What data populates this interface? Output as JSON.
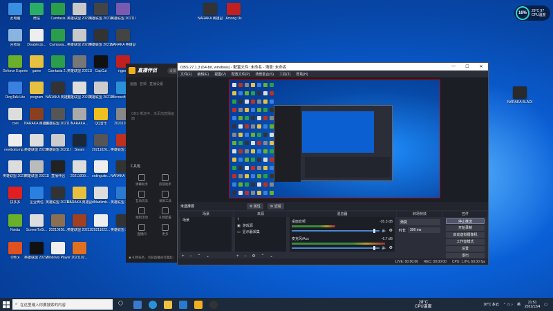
{
  "desktop": {
    "icons": [
      {
        "label": "此电脑",
        "color": "#3b8fe0"
      },
      {
        "label": "微信",
        "color": "#2aae67"
      },
      {
        "label": "Camtasia",
        "color": "#2a9e4a"
      },
      {
        "label": "英雄联盟 2021100...",
        "color": "#c9c9c9"
      },
      {
        "label": "英雄联盟 2021100...",
        "color": "#444"
      },
      {
        "label": "英雄联盟 2021100...",
        "color": "#7a5ab0"
      },
      {
        "label": "回收站",
        "color": "#8ab4e0"
      },
      {
        "label": "DisableUp...",
        "color": "#eee"
      },
      {
        "label": "Camtasia...",
        "color": "#2a9e4a"
      },
      {
        "label": "英雄联盟 2021100...",
        "color": "#c9c9c9"
      },
      {
        "label": "英雄联盟 2021100...",
        "color": "#333"
      },
      {
        "label": "NARAKA 英雄副本...",
        "color": "#444"
      },
      {
        "label": "Geforce Experience",
        "color": "#6ab02a"
      },
      {
        "label": "game",
        "color": "#e8c040"
      },
      {
        "label": "Camtasia 2...",
        "color": "#2a9e4a"
      },
      {
        "label": "英雄联盟 2021100...",
        "color": "#777"
      },
      {
        "label": "CapCut",
        "color": "#111"
      },
      {
        "label": "rigpo1",
        "color": "#c02020"
      },
      {
        "label": "DingTalk Lite",
        "color": "#3a80e0"
      },
      {
        "label": "program",
        "color": "#e8c040"
      },
      {
        "label": "NARAKA 英雄副本...",
        "color": "#333"
      },
      {
        "label": "英雄联盟 2021100...",
        "color": "#ddd"
      },
      {
        "label": "英雄联盟 2021100...",
        "color": "#ccc"
      },
      {
        "label": "Microsoft Edge",
        "color": "#2a90d8"
      },
      {
        "label": "cool",
        "color": "#ddd"
      },
      {
        "label": "NARAKA 英雄副本...",
        "color": "#8a4020"
      },
      {
        "label": "英雄联盟 2021100...",
        "color": "#555"
      },
      {
        "label": "NARAKA...",
        "color": "#aaa"
      },
      {
        "label": "QQ音乐",
        "color": "#f0c020"
      },
      {
        "label": "20211011...",
        "color": "#888"
      },
      {
        "label": "newbottomp...",
        "color": "#eee"
      },
      {
        "label": "英雄联盟 2021100...",
        "color": "#ddd"
      },
      {
        "label": "英雄联盟 2021100...",
        "color": "#ccc"
      },
      {
        "label": "Steam",
        "color": "#1b2838"
      },
      {
        "label": "20211026...",
        "color": "#555"
      },
      {
        "label": "英雄联盟 2021100...",
        "color": "#c03020"
      },
      {
        "label": "英雄联盟 2021100...",
        "color": "#ddd"
      },
      {
        "label": "英雄联盟 2021100...",
        "color": "#bbb"
      },
      {
        "label": "直播伴侣",
        "color": "#222"
      },
      {
        "label": "20211009...",
        "color": "#ddd"
      },
      {
        "label": "ordinguitn...",
        "color": "#eee"
      },
      {
        "label": "NARAKA 英雄副本...",
        "color": "#333"
      },
      {
        "label": "拼多多",
        "color": "#e02020"
      },
      {
        "label": "企业微信",
        "color": "#2a80e0"
      },
      {
        "label": "英雄联盟 2021100...",
        "color": "#333"
      },
      {
        "label": "NARAKA 英雄副本...",
        "color": "#e8c040"
      },
      {
        "label": "dMadkmb...",
        "color": "#ddd"
      },
      {
        "label": "英雄联盟 2021100...",
        "color": "#2a7ad0"
      },
      {
        "label": "Nvidia",
        "color": "#6ab02a"
      },
      {
        "label": "ScreenToGi...",
        "color": "#ddd"
      },
      {
        "label": "20210928...",
        "color": "#8a7050"
      },
      {
        "label": "英雄联盟 2021100...",
        "color": "#a04020"
      },
      {
        "label": "20211022...",
        "color": "#eee"
      },
      {
        "label": "英雄联盟 2021100...",
        "color": "#333"
      },
      {
        "label": "Office",
        "color": "#e05020"
      },
      {
        "label": "英雄联盟 2021100...",
        "color": "#111"
      },
      {
        "label": "Windows Player",
        "color": "#eee"
      },
      {
        "label": "2021102...",
        "color": "#e07020"
      },
      {
        "label": "NARAKA BLADEPOI...",
        "color": "#2a2a2a"
      },
      {
        "label": "NARAKA 英雄副本...",
        "color": "#333"
      },
      {
        "label": "Among Us",
        "color": "#c02020"
      }
    ]
  },
  "widget": {
    "percent": "16%",
    "temp": "28°C 97",
    "cpu": "CPU温度"
  },
  "zhibo": {
    "title": "直播伴侣",
    "pill": "设置",
    "tabs": [
      "画面",
      "音频",
      "直播设置"
    ],
    "empty_hint": "OBS 推流中，未添加直播画面",
    "tools_title": "工具箱",
    "tools": [
      "弹幕助手",
      "房管助手",
      "互动玩法",
      "录屏工具",
      "福利活动",
      "礼物配置",
      "直播间",
      "更多"
    ],
    "footer": "◉ 礼物任务、点获直播间可赢起 ›"
  },
  "obs": {
    "title": "OBS 27.1.3 (64-bit, windows) - 配置文件: 未命名 - 场景: 未命名",
    "window_controls": [
      "—",
      "☐",
      "✕"
    ],
    "menu": [
      "文件(F)",
      "编辑(E)",
      "视图(V)",
      "配置文件(P)",
      "场景集合(S)",
      "工具(T)",
      "帮助(H)"
    ],
    "source_strip": {
      "label": "未选择源",
      "props": "⚙ 属性",
      "filters": "⚙ 滤镜"
    },
    "docks": {
      "scenes": {
        "title": "场景",
        "items": [
          "场景"
        ]
      },
      "sources": {
        "title": "来源",
        "items": [
          "T",
          "游戏源",
          "显示器采集"
        ]
      },
      "mixer": {
        "title": "混音器",
        "channels": [
          {
            "name": "桌面音频",
            "level": "-35.3 dB",
            "db_value": -35.3
          },
          {
            "name": "麦克风/Aux",
            "level": "-6.7 dB",
            "db_value": -6.7
          }
        ]
      },
      "transitions": {
        "title": "转场特效",
        "type": "渐变",
        "duration_label": "时长",
        "duration": "300 ms"
      },
      "controls": {
        "title": "控件",
        "buttons": [
          "停止推流",
          "开始录制",
          "启动虚拟摄像机",
          "工作室模式",
          "设置",
          "退出"
        ]
      }
    },
    "status": {
      "live": "LIVE: 00:00:00",
      "rec": "REC: 00:00:00",
      "cpu": "CPU: 1.0%, 60.00 fps"
    }
  },
  "taskbar": {
    "search_placeholder": "在这里输入你要搜索的内容",
    "weather": "16°C 多云",
    "tray_temp": "28°C",
    "tray_cpu": "CPU温度",
    "time": "21:51",
    "date": "2021/12/4",
    "lang": "英"
  }
}
